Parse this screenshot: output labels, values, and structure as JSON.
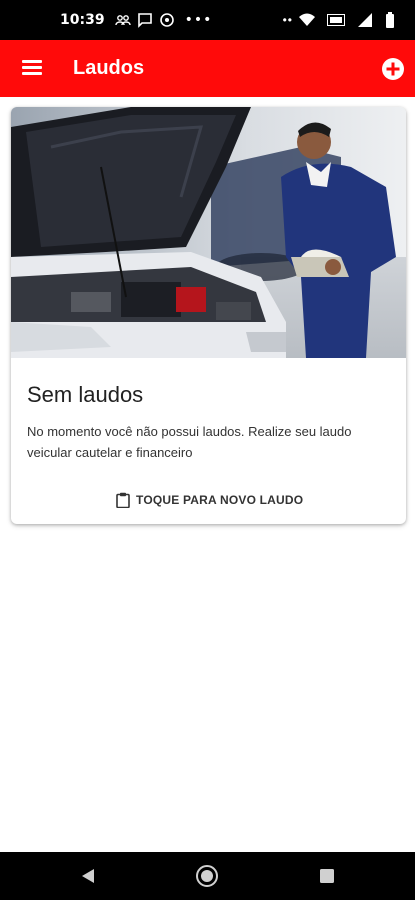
{
  "status_bar": {
    "time": "10:39",
    "dots": "•••",
    "icons": [
      "people-icon",
      "message-icon",
      "data-saver-icon",
      "signal-icon",
      "volte-icon",
      "wifi-icon",
      "battery-icon"
    ]
  },
  "app_bar": {
    "title": "Laudos",
    "color": "#ff0a0a",
    "menu_icon": "menu-icon",
    "add_icon": "add-circle-icon"
  },
  "empty_state": {
    "image": "mechanic-inspecting-car-photo",
    "title": "Sem laudos",
    "message": "No momento você não possui laudos. Realize seu laudo veicular cautelar e financeiro",
    "action_label": "TOQUE PARA NOVO LAUDO",
    "action_icon": "clipboard-icon"
  },
  "nav_bar": {
    "icons": [
      "back-icon",
      "home-icon",
      "recent-apps-icon"
    ]
  }
}
